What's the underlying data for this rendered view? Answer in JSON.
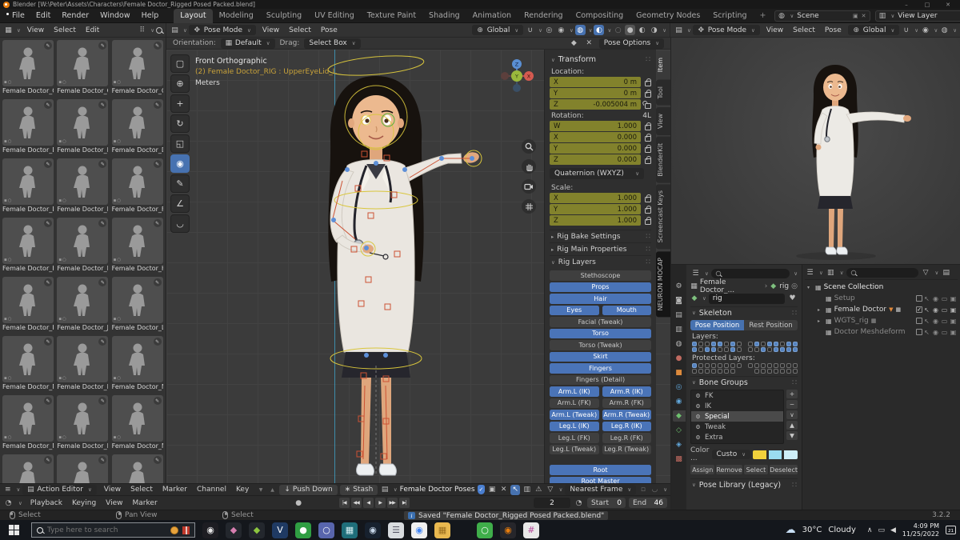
{
  "window": {
    "title": "Blender [W:\\Peter\\Assets\\Characters\\Female Doctor_Rigged Posed Packed.blend]",
    "minimize": "–",
    "maximize": "□",
    "close": "✕"
  },
  "menubar": {
    "menus": [
      "File",
      "Edit",
      "Render",
      "Window",
      "Help"
    ],
    "workspaces": [
      {
        "label": "Layout",
        "cls": "active"
      },
      {
        "label": "Modeling"
      },
      {
        "label": "Sculpting"
      },
      {
        "label": "UV Editing"
      },
      {
        "label": "Texture Paint"
      },
      {
        "label": "Shading"
      },
      {
        "label": "Animation"
      },
      {
        "label": "Rendering"
      },
      {
        "label": "Compositing"
      },
      {
        "label": "Geometry Nodes"
      },
      {
        "label": "Scripting"
      },
      {
        "label": "+",
        "cls": "plus"
      }
    ],
    "scene_label": "Scene",
    "view_layer_label": "View Layer"
  },
  "asset_browser": {
    "menus": [
      "View",
      "Select",
      "Edit"
    ],
    "items": [
      {
        "label": "Female Doctor_Co.."
      },
      {
        "label": "Female Doctor_Co.."
      },
      {
        "label": "Female Doctor_Cro"
      },
      {
        "label": "Female Doctor_Def"
      },
      {
        "label": "Female Doctor_Def"
      },
      {
        "label": "Female Doctor_De.."
      },
      {
        "label": "Female Doctor_De.."
      },
      {
        "label": "Female Doctor_De.."
      },
      {
        "label": "Female Doctor_Fe.."
      },
      {
        "label": "Female Doctor_Ha.."
      },
      {
        "label": "Female Doctor_Hol"
      },
      {
        "label": "Female Doctor_Hol"
      },
      {
        "label": "Female Doctor_Hol"
      },
      {
        "label": "Female Doctor_Ju.."
      },
      {
        "label": "Female Doctor_Le.."
      },
      {
        "label": "Female Doctor_Me.."
      },
      {
        "label": "Female Doctor_Me.."
      },
      {
        "label": "Female Doctor_No.."
      },
      {
        "label": "Female Doctor_No.."
      },
      {
        "label": "Female Doctor_No.."
      },
      {
        "label": "Female Doctor_No.."
      },
      {
        "label": ""
      },
      {
        "label": ""
      },
      {
        "label": ""
      }
    ]
  },
  "viewport": {
    "mode": "Pose Mode",
    "menus": [
      "View",
      "Select",
      "Pose"
    ],
    "orientation_label": "Orientation:",
    "orientation_value": "Default",
    "drag_label": "Drag:",
    "drag_value": "Select Box",
    "transform_orientation": "Global",
    "pose_options_label": "Pose Options",
    "overlay": {
      "view": "Front Orthographic",
      "object": "(2) Female Doctor_RIG : UpperEyeLid_L",
      "unit": "Meters"
    },
    "gizmo_axes": {
      "x": "X",
      "y": "Y",
      "z": "Z"
    },
    "tools": [
      {
        "name": "select-box-tool",
        "glyph": "▢"
      },
      {
        "name": "cursor-tool",
        "glyph": "⊕"
      },
      {
        "name": "move-tool",
        "glyph": "+"
      },
      {
        "name": "rotate-tool",
        "glyph": "↻"
      },
      {
        "name": "scale-tool",
        "glyph": "◱"
      },
      {
        "name": "transform-tool",
        "glyph": "◉",
        "cls": "active"
      },
      {
        "name": "annotate-tool",
        "glyph": "✎"
      },
      {
        "name": "measure-tool",
        "glyph": "∠"
      },
      {
        "name": "pose-breakdowner-tool",
        "glyph": "◡"
      }
    ]
  },
  "right_viewport": {
    "mode": "Pose Mode",
    "menus": [
      "View",
      "Select",
      "Pose"
    ],
    "transform_orientation": "Global"
  },
  "npanel": {
    "tabs": [
      {
        "label": "Item",
        "cls": "active"
      },
      {
        "label": "Tool"
      },
      {
        "label": "View"
      },
      {
        "label": "BlenderKit"
      },
      {
        "label": "Screencast Keys"
      },
      {
        "label": "NEURON MOCAP",
        "cls": "dark"
      }
    ],
    "transform_title": "Transform",
    "location_label": "Location:",
    "location": [
      {
        "axis": "X",
        "value": "0 m"
      },
      {
        "axis": "Y",
        "value": "0 m"
      },
      {
        "axis": "Z",
        "value": "-0.005004 m",
        "cls": "un"
      }
    ],
    "rotation_label": "Rotation:",
    "rotation_indicator": "4L",
    "rotation": [
      {
        "axis": "W",
        "value": "1.000"
      },
      {
        "axis": "X",
        "value": "0.000"
      },
      {
        "axis": "Y",
        "value": "0.000"
      },
      {
        "axis": "Z",
        "value": "0.000"
      }
    ],
    "rotation_mode": "Quaternion (WXYZ)",
    "scale_label": "Scale:",
    "scale": [
      {
        "axis": "X",
        "value": "1.000"
      },
      {
        "axis": "Y",
        "value": "1.000"
      },
      {
        "axis": "Z",
        "value": "1.000"
      }
    ],
    "collapsed_panels": [
      "Rig Bake Settings",
      "Rig Main Properties"
    ],
    "rig_layers_title": "Rig Layers",
    "rig_layers": [
      {
        "label": "Stethoscope"
      },
      {
        "label": "Props",
        "cls": "on"
      },
      {
        "label": "Hair",
        "cls": "on"
      },
      {
        "label": "Eyes",
        "cls": "half on"
      },
      {
        "label": "Mouth",
        "cls": "half on"
      },
      {
        "label": "Facial (Tweak)"
      },
      {
        "label": "Torso",
        "cls": "on"
      },
      {
        "label": "Torso (Tweak)"
      },
      {
        "label": "Skirt",
        "cls": "on"
      },
      {
        "label": "Fingers",
        "cls": "on"
      },
      {
        "label": "Fingers (Detail)"
      },
      {
        "label": "Arm.L (IK)",
        "cls": "half on"
      },
      {
        "label": "Arm.R (IK)",
        "cls": "half on"
      },
      {
        "label": "Arm.L (FK)",
        "cls": "half"
      },
      {
        "label": "Arm.R (FK)",
        "cls": "half"
      },
      {
        "label": "Arm.L (Tweak)",
        "cls": "half on"
      },
      {
        "label": "Arm.R (Tweak)",
        "cls": "half on"
      },
      {
        "label": "Leg.L (IK)",
        "cls": "half on"
      },
      {
        "label": "Leg.R (IK)",
        "cls": "half on"
      },
      {
        "label": "Leg.L (FK)",
        "cls": "half"
      },
      {
        "label": "Leg.R (FK)",
        "cls": "half"
      },
      {
        "label": "Leg.L (Tweak)",
        "cls": "half"
      },
      {
        "label": "Leg.R (Tweak)",
        "cls": "half"
      },
      {
        "label": "Root",
        "cls": "on gap"
      },
      {
        "label": "Root Master",
        "cls": "on"
      }
    ]
  },
  "properties": {
    "breadcrumb_object": "Female Doctor_...",
    "breadcrumb_sep": "›",
    "breadcrumb_data": "rig",
    "name_value": "rig",
    "skeleton_title": "Skeleton",
    "pose_position_label": "Pose Position",
    "rest_position_label": "Rest Position",
    "layers_label": "Layers:",
    "layers_row1": "10011010 01011011",
    "layers_row2": "10110010 00101111",
    "protected_label": "Protected Layers:",
    "protected_row1": "10000000 00000000",
    "protected_row2": "0000000. .0000000",
    "bone_groups_title": "Bone Groups",
    "bone_groups": [
      {
        "label": "FK"
      },
      {
        "label": "IK"
      },
      {
        "label": "Special",
        "cls": "selected"
      },
      {
        "label": "Tweak"
      },
      {
        "label": "Extra"
      }
    ],
    "list_buttons": [
      {
        "name": "add-bone-group-button",
        "glyph": "+"
      },
      {
        "name": "remove-bone-group-button",
        "glyph": "−"
      },
      {
        "name": "bone-group-specials-button",
        "glyph": "∨"
      },
      {
        "name": "move-up-button",
        "glyph": "▲"
      },
      {
        "name": "move-down-button",
        "glyph": "▼"
      }
    ],
    "color_label": "Color ...",
    "color_set_value": "Custo",
    "colors": [
      "#f2d23c",
      "#9adcf0",
      "#cdeef8"
    ],
    "action_buttons": [
      "Assign",
      "Remove",
      "Select",
      "Deselect"
    ],
    "pose_library_title": "Pose Library (Legacy)",
    "tabs": [
      {
        "name": "tool-tab",
        "glyph": "⚙",
        "fg": "#b4b4b4"
      },
      {
        "name": "render-tab",
        "glyph": "◙",
        "fg": "#b4b4b4"
      },
      {
        "name": "output-tab",
        "glyph": "▤",
        "fg": "#b4b4b4"
      },
      {
        "name": "view-layer-tab",
        "glyph": "▥",
        "fg": "#b4b4b4"
      },
      {
        "name": "scene-tab",
        "glyph": "◍",
        "fg": "#b4b4b4"
      },
      {
        "name": "world-tab",
        "glyph": "●",
        "fg": "#c06a60"
      },
      {
        "name": "object-tab",
        "glyph": "■",
        "fg": "#dd8a3c"
      },
      {
        "name": "physics-tab",
        "glyph": "◎",
        "fg": "#62a8dc"
      },
      {
        "name": "constraints-tab",
        "glyph": "◉",
        "fg": "#62a8dc"
      },
      {
        "name": "object-data-tab",
        "glyph": "◆",
        "fg": "#6ec06e",
        "cls": "active"
      },
      {
        "name": "bone-tab",
        "glyph": "◇",
        "fg": "#6ec06e"
      },
      {
        "name": "bone-constraints-tab",
        "glyph": "◈",
        "fg": "#62a8dc"
      },
      {
        "name": "texture-tab",
        "glyph": "▩",
        "fg": "#c06a60"
      }
    ]
  },
  "outliner": {
    "root_label": "Scene Collection",
    "rows": [
      {
        "label": "Setup",
        "cls": "dim",
        "expand": ""
      },
      {
        "label": "Female Doctor",
        "cls": "lit badged checked",
        "expand": "▸"
      },
      {
        "label": "WGTS_rig",
        "cls": "dim extra",
        "expand": "▸"
      },
      {
        "label": "Doctor Meshdeform",
        "cls": "dim",
        "expand": ""
      }
    ]
  },
  "dopesheet": {
    "editor_label": "Action Editor",
    "menus": [
      "View",
      "Select",
      "Marker",
      "Channel",
      "Key"
    ],
    "push_down_label": "Push Down",
    "stash_label": "Stash",
    "action_name": "Female Doctor Poses",
    "snap_label": "Nearest Frame"
  },
  "timeline": {
    "menus": [
      "Playback",
      "Keying",
      "View",
      "Marker"
    ],
    "controls": [
      "|◀",
      "◀◀",
      "◀",
      "▶",
      "▶▶",
      "▶|"
    ],
    "frame_current": "2",
    "start_label": "Start",
    "start_value": "0",
    "end_label": "End",
    "end_value": "46"
  },
  "statusbar": {
    "hints": [
      {
        "label": "Select",
        "cls": "l",
        "name": "lmb-hint"
      },
      {
        "label": "Pan View",
        "cls": "m",
        "name": "mmb-hint"
      },
      {
        "label": "Select",
        "cls": "r",
        "name": "rmb-hint"
      }
    ],
    "message": "Saved \"Female Doctor_Rigged Posed Packed.blend\"",
    "version": "3.2.2"
  },
  "taskbar": {
    "search_placeholder": "Type here to search",
    "apps": [
      {
        "name": "webcam-app",
        "glyph": "◉",
        "bg": "#1d1d22",
        "fg": "#e8e8e8"
      },
      {
        "name": "paint-app",
        "glyph": "◆",
        "bg": "#23272d",
        "fg": "#d77fb0"
      },
      {
        "name": "asset-app",
        "glyph": "◆",
        "bg": "#23272d",
        "fg": "#8cc63f"
      },
      {
        "name": "vscode-app",
        "glyph": "V",
        "bg": "#1f3a63",
        "fg": "#ffffff"
      },
      {
        "name": "green-app",
        "glyph": "●",
        "bg": "#2f9e43",
        "fg": "#ffffff"
      },
      {
        "name": "discord-app",
        "glyph": "○",
        "bg": "#5865ad",
        "fg": "#ffffff"
      },
      {
        "name": "calculator-app",
        "glyph": "▦",
        "bg": "#1f6e7a",
        "fg": "#d8f0f4"
      },
      {
        "name": "steam-app",
        "glyph": "◉",
        "bg": "#17212e",
        "fg": "#c8d8ea"
      },
      {
        "name": "notes-app",
        "glyph": "☰",
        "bg": "#d8dce0",
        "fg": "#555566"
      },
      {
        "name": "chrome-app",
        "glyph": "◉",
        "bg": "#f0f0f0",
        "fg": "#4285f4"
      },
      {
        "name": "folder-app",
        "glyph": "▦",
        "bg": "#e8b84f",
        "fg": "#9a6e1f"
      },
      {
        "name": "whatsapp-app",
        "glyph": "○",
        "bg": "#3fae4a",
        "fg": "#ffffff",
        "cls": "grp2"
      },
      {
        "name": "blender-app",
        "glyph": "◉",
        "bg": "#26262b",
        "fg": "#e87d0d"
      },
      {
        "name": "slack-app",
        "glyph": "#",
        "bg": "#e8e8e8",
        "fg": "#b5489a"
      }
    ],
    "tray_icons": [
      {
        "name": "hidden-icons-chevron",
        "glyph": "∧"
      },
      {
        "name": "network-icon",
        "glyph": "▭"
      },
      {
        "name": "volume-icon",
        "glyph": "◀"
      }
    ],
    "weather_temp": "30°C",
    "weather_desc": "Cloudy",
    "time": "4:09 PM",
    "date": "11/25/2022",
    "notification_count": "21"
  }
}
